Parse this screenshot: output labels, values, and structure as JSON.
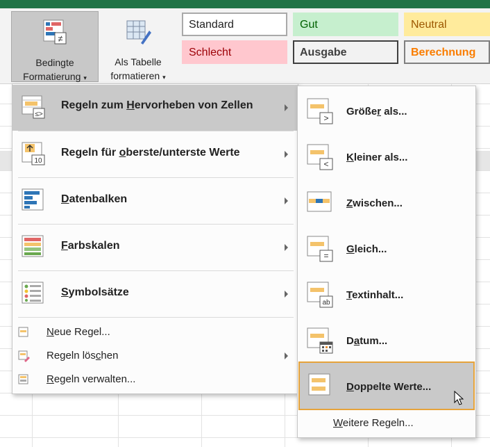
{
  "ribbon": {
    "conditional_label_1": "Bedingte",
    "conditional_label_2": "Formatierung",
    "table_label_1": "Als Tabelle",
    "table_label_2": "formatieren",
    "styles": [
      {
        "label": "Standard",
        "bg": "#ffffff",
        "color": "#222222",
        "border": "#a9a9a9"
      },
      {
        "label": "Gut",
        "bg": "#c6efce",
        "color": "#006100",
        "border": "#c6efce"
      },
      {
        "label": "Neutral",
        "bg": "#ffeb9c",
        "color": "#9c5700",
        "border": "#ffeb9c"
      },
      {
        "label": "Schlecht",
        "bg": "#ffc7ce",
        "color": "#9c0006",
        "border": "#ffc7ce"
      },
      {
        "label": "Ausgabe",
        "bg": "#f2f2f2",
        "color": "#3f3f3f",
        "border": "#3f3f3f"
      },
      {
        "label": "Berechnung",
        "bg": "#f2f2f2",
        "color": "#fa7d00",
        "border": "#7f7f7f"
      }
    ]
  },
  "main_menu": {
    "items": [
      {
        "label_pre": "Regeln zum ",
        "label_ul": "H",
        "label_post": "ervorheben von Zellen"
      },
      {
        "label_pre": "Regeln für ",
        "label_ul": "o",
        "label_post": "berste/unterste Werte"
      },
      {
        "label_pre": "",
        "label_ul": "D",
        "label_post": "atenbalken"
      },
      {
        "label_pre": "",
        "label_ul": "F",
        "label_post": "arbskalen"
      },
      {
        "label_pre": "",
        "label_ul": "S",
        "label_post": "ymbolsätze"
      },
      {
        "label_pre": "",
        "label_ul": "N",
        "label_post": "eue Regel..."
      },
      {
        "label_pre": "Regeln lös",
        "label_ul": "c",
        "label_post": "hen"
      },
      {
        "label_pre": "",
        "label_ul": "R",
        "label_post": "egeln verwalten..."
      }
    ]
  },
  "sub_menu": {
    "items": [
      {
        "label_pre": "Größe",
        "label_ul": "r",
        "label_post": " als..."
      },
      {
        "label_pre": "",
        "label_ul": "K",
        "label_post": "leiner als..."
      },
      {
        "label_pre": "",
        "label_ul": "Z",
        "label_post": "wischen..."
      },
      {
        "label_pre": "",
        "label_ul": "G",
        "label_post": "leich..."
      },
      {
        "label_pre": "",
        "label_ul": "T",
        "label_post": "extinhalt..."
      },
      {
        "label_pre": "D",
        "label_ul": "a",
        "label_post": "tum..."
      },
      {
        "label_pre": "",
        "label_ul": "D",
        "label_post": "oppelte Werte..."
      }
    ],
    "more_pre": "",
    "more_ul": "W",
    "more_post": "eitere Regeln..."
  },
  "colors": {
    "excel_green": "#217346",
    "highlight": "#c9c9c9",
    "focus_border": "#e6a33a"
  }
}
